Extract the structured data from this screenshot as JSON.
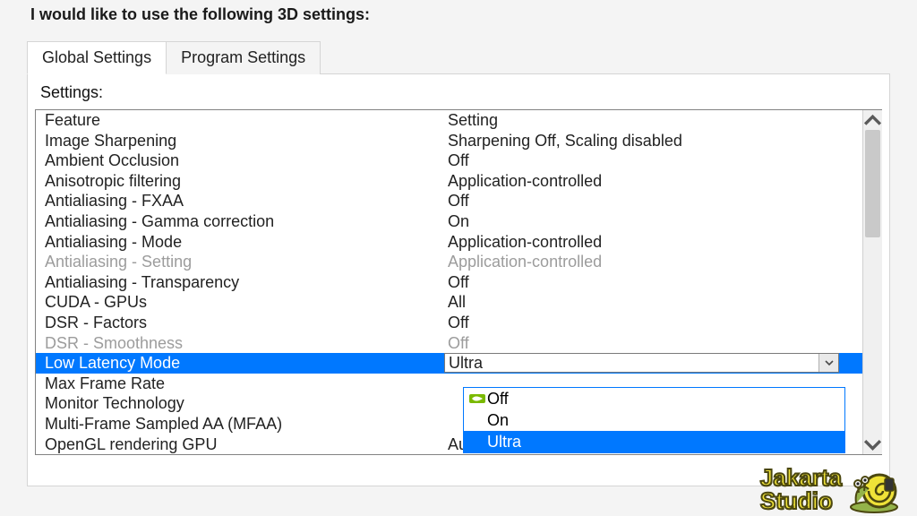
{
  "header": {
    "prompt": "I would like to use the following 3D settings:"
  },
  "tabs": {
    "active": 0,
    "items": [
      "Global Settings",
      "Program Settings"
    ]
  },
  "settings_label": "Settings:",
  "columns": {
    "feature": "Feature",
    "setting": "Setting"
  },
  "rows": [
    {
      "feature": "Image Sharpening",
      "setting": "Sharpening Off, Scaling disabled",
      "disabled": false,
      "selected": false
    },
    {
      "feature": "Ambient Occlusion",
      "setting": "Off",
      "disabled": false,
      "selected": false
    },
    {
      "feature": "Anisotropic filtering",
      "setting": "Application-controlled",
      "disabled": false,
      "selected": false
    },
    {
      "feature": "Antialiasing - FXAA",
      "setting": "Off",
      "disabled": false,
      "selected": false
    },
    {
      "feature": "Antialiasing - Gamma correction",
      "setting": "On",
      "disabled": false,
      "selected": false
    },
    {
      "feature": "Antialiasing - Mode",
      "setting": "Application-controlled",
      "disabled": false,
      "selected": false
    },
    {
      "feature": "Antialiasing - Setting",
      "setting": "Application-controlled",
      "disabled": true,
      "selected": false
    },
    {
      "feature": "Antialiasing - Transparency",
      "setting": "Off",
      "disabled": false,
      "selected": false
    },
    {
      "feature": "CUDA - GPUs",
      "setting": "All",
      "disabled": false,
      "selected": false
    },
    {
      "feature": "DSR - Factors",
      "setting": "Off",
      "disabled": false,
      "selected": false
    },
    {
      "feature": "DSR - Smoothness",
      "setting": "Off",
      "disabled": true,
      "selected": false
    },
    {
      "feature": "Low Latency Mode",
      "setting": "Ultra",
      "disabled": false,
      "selected": true
    },
    {
      "feature": "Max Frame Rate",
      "setting": "",
      "disabled": false,
      "selected": false
    },
    {
      "feature": "Monitor Technology",
      "setting": "",
      "disabled": false,
      "selected": false
    },
    {
      "feature": "Multi-Frame Sampled AA (MFAA)",
      "setting": "",
      "disabled": false,
      "selected": false
    },
    {
      "feature": "OpenGL rendering GPU",
      "setting": "Auto-select",
      "disabled": false,
      "selected": false
    }
  ],
  "dropdown": {
    "open_for": "Low Latency Mode",
    "options": [
      {
        "label": "Off",
        "checked": true,
        "highlight": false
      },
      {
        "label": "On",
        "checked": false,
        "highlight": false
      },
      {
        "label": "Ultra",
        "checked": false,
        "highlight": true
      }
    ]
  },
  "logo": {
    "line1": "Jakarta",
    "line2": "Studio"
  }
}
